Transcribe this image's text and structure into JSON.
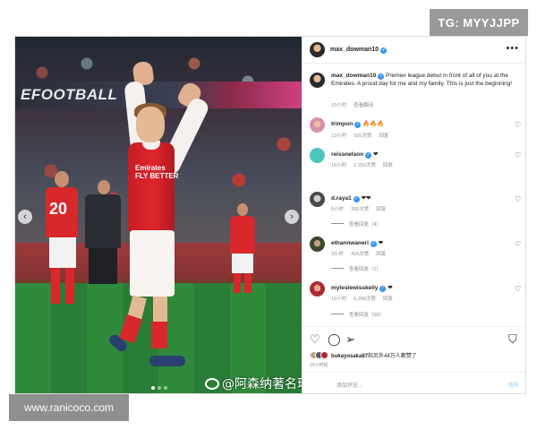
{
  "overlay": {
    "tg_badge": "TG: MYYJJPP",
    "site_badge": "www.ranicoco.com",
    "watermark": "@阿森纳著名球迷"
  },
  "photo": {
    "banner_text": "EFOOTBALL",
    "sponsor_line1": "Emirates",
    "sponsor_line2": "FLY BETTER",
    "bg_player_number": "20"
  },
  "post": {
    "author": "max_dowman10",
    "caption_author": "max_dowman10",
    "caption": "Premier league debut in front of all of you at the Emirates. A proud day for me and my family. This is just the beginning!",
    "caption_time": "15小时",
    "caption_translate": "查看翻译",
    "comments": [
      {
        "user": "trimpon",
        "text": "🔥🔥🔥",
        "time": "13小时",
        "likes": "505次赞",
        "reply": "回复",
        "view_replies": ""
      },
      {
        "user": "reissnelson",
        "text": "❤",
        "time": "15小时",
        "likes": "2,252次赞",
        "reply": "回复",
        "view_replies": ""
      },
      {
        "user": "d.raya1",
        "text": "❤❤",
        "time": "5小时",
        "likes": "355次赞",
        "reply": "回复",
        "view_replies": "查看回复（4）"
      },
      {
        "user": "ethannwaneri",
        "text": "❤",
        "time": "3小时",
        "likes": "416次赞",
        "reply": "回复",
        "view_replies": "查看回复（1）"
      },
      {
        "user": "myleslewisskelly",
        "text": "❤",
        "time": "15小时",
        "likes": "6,268次赞",
        "reply": "回复",
        "view_replies": "查看回复（98）"
      }
    ],
    "likes_text_bold": "bukayosaka87",
    "likes_text": "和另外44万人都赞了",
    "date": "15小时前",
    "comment_placeholder": "添加评论...",
    "post_button": "发布"
  }
}
